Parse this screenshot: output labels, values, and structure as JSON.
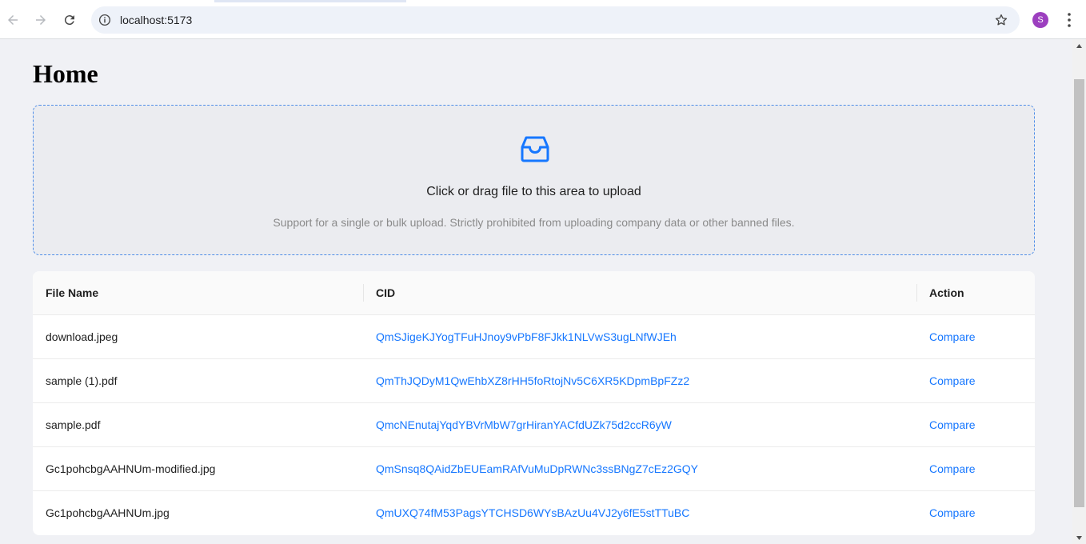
{
  "browser": {
    "url": "localhost:5173",
    "profile_initial": "S",
    "icons": [
      "back-arrow-icon",
      "forward-arrow-icon",
      "reload-icon",
      "site-info-icon",
      "bookmark-star-icon",
      "more-vert-icon"
    ]
  },
  "page": {
    "title": "Home"
  },
  "upload": {
    "icon": "inbox-icon",
    "main_text": "Click or drag file to this area to upload",
    "hint_text": "Support for a single or bulk upload. Strictly prohibited from uploading company data or other banned files.",
    "accent_color": "#1677ff"
  },
  "table": {
    "headers": {
      "file_name": "File Name",
      "cid": "CID",
      "action": "Action"
    },
    "rows": [
      {
        "file_name": "download.jpeg",
        "cid": "QmSJigeKJYogTFuHJnoy9vPbF8FJkk1NLVwS3ugLNfWJEh",
        "action": "Compare"
      },
      {
        "file_name": "sample (1).pdf",
        "cid": "QmThJQDyM1QwEhbXZ8rHH5foRtojNv5C6XR5KDpmBpFZz2",
        "action": "Compare"
      },
      {
        "file_name": "sample.pdf",
        "cid": "QmcNEnutajYqdYBVrMbW7grHiranYACfdUZk75d2ccR6yW",
        "action": "Compare"
      },
      {
        "file_name": "Gc1pohcbgAAHNUm-modified.jpg",
        "cid": "QmSnsq8QAidZbEUEamRAfVuMuDpRWNc3ssBNgZ7cEz2GQY",
        "action": "Compare"
      },
      {
        "file_name": "Gc1pohcbgAAHNUm.jpg",
        "cid": "QmUXQ74fM53PagsYTCHSD6WYsBAzUu4VJ2y6fE5stTTuBC",
        "action": "Compare"
      }
    ]
  }
}
